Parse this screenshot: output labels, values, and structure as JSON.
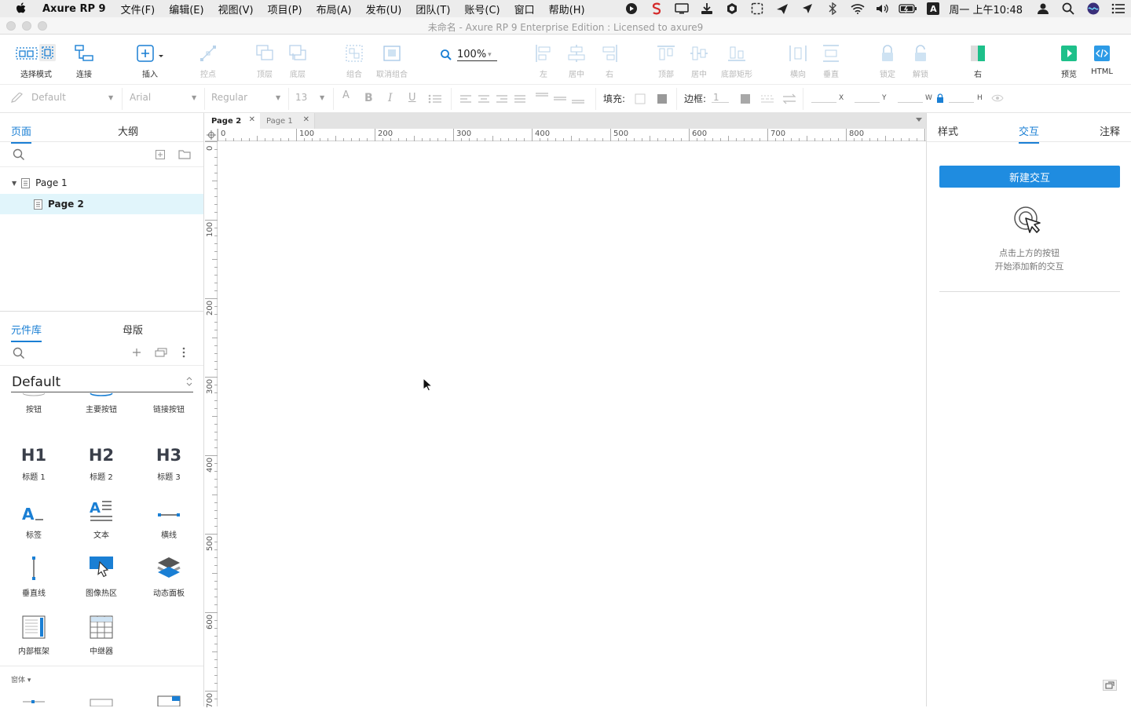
{
  "menubar": {
    "app_name": "Axure RP 9",
    "items": [
      "文件(F)",
      "编辑(E)",
      "视图(V)",
      "项目(P)",
      "布局(A)",
      "发布(U)",
      "团队(T)",
      "账号(C)",
      "窗口",
      "帮助(H)"
    ],
    "clock": "周一 上午10:48",
    "input_indicator": "A"
  },
  "window": {
    "title": "未命名 - Axure RP 9 Enterprise Edition : Licensed to axure9"
  },
  "toolbar": {
    "select_mode": "选择模式",
    "connect": "连接",
    "insert": "插入",
    "points": "控点",
    "front": "顶层",
    "back": "底层",
    "group": "组合",
    "ungroup": "取消组合",
    "zoom": "100%",
    "align_left": "左",
    "align_center": "居中",
    "align_right": "右",
    "align_top": "顶部",
    "align_middle": "居中",
    "align_bottom": "底部矩形",
    "distribute_h": "横向",
    "distribute_v": "垂直",
    "lock": "锁定",
    "unlock": "解锁",
    "right_toggle": "右",
    "preview": "预览",
    "html": "HTML"
  },
  "formatbar": {
    "style": "Default",
    "font": "Arial",
    "weight": "Regular",
    "size": "13",
    "fill_label": "填充:",
    "border_label": "边框:",
    "border_value": "1",
    "x_label": "X",
    "y_label": "Y",
    "w_label": "W",
    "h_label": "H"
  },
  "left": {
    "tab_pages": "页面",
    "tab_outline": "大纲",
    "pages": [
      {
        "label": "Page 1"
      },
      {
        "label": "Page 2"
      }
    ],
    "tab_library": "元件库",
    "tab_masters": "母版",
    "library_name": "Default",
    "widgets": [
      {
        "label": "按钮"
      },
      {
        "label": "主要按钮"
      },
      {
        "label": "链接按钮"
      },
      {
        "label": "标题 1",
        "glyph": "H1"
      },
      {
        "label": "标题 2",
        "glyph": "H2"
      },
      {
        "label": "标题 3",
        "glyph": "H3"
      },
      {
        "label": "标签"
      },
      {
        "label": "文本"
      },
      {
        "label": "横线"
      },
      {
        "label": "垂直线"
      },
      {
        "label": "图像热区"
      },
      {
        "label": "动态面板"
      },
      {
        "label": "内部框架"
      },
      {
        "label": "中继器"
      }
    ],
    "forms_section": "窗体 ▾"
  },
  "canvas": {
    "tabs": [
      {
        "label": "Page 2",
        "active": true
      },
      {
        "label": "Page 1",
        "active": false
      }
    ],
    "ruler_h": [
      "0",
      "100",
      "200",
      "300",
      "400",
      "500",
      "600",
      "700",
      "800"
    ],
    "ruler_v": [
      "0",
      "100",
      "200",
      "300",
      "400",
      "500",
      "600",
      "700"
    ]
  },
  "right": {
    "tab_style": "样式",
    "tab_interactions": "交互",
    "tab_notes": "注释",
    "new_interaction": "新建交互",
    "hint_line1": "点击上方的按钮",
    "hint_line2": "开始添加新的交互"
  },
  "colors": {
    "accent": "#1f8ce0",
    "tab_active": "#1a7fd4",
    "selected_row": "#e1f5fb",
    "preview_green": "#1ec08a"
  }
}
